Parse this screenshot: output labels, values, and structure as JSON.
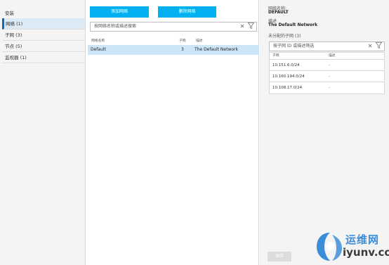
{
  "nav": {
    "title": "安装",
    "items": [
      {
        "label": "网络 (1)",
        "selected": true
      },
      {
        "label": "子网 (3)",
        "selected": false
      },
      {
        "label": "节点 (5)",
        "selected": false
      },
      {
        "label": "监视器 (1)",
        "selected": false
      }
    ]
  },
  "middle": {
    "add_button": "添加网络",
    "delete_button": "删除网络",
    "search_placeholder": "按网络名称或描述搜索",
    "columns": [
      "网络名称",
      "子网",
      "描述"
    ],
    "rows": [
      {
        "name": "Default",
        "subnets": "3",
        "description": "The Default Network"
      }
    ]
  },
  "right": {
    "name_label": "网络名称:",
    "name_value": "DEFAULT",
    "desc_label": "描述",
    "desc_value": "The Default Network",
    "unassigned_label": "未分配的子网 (3)",
    "filter_placeholder": "按子网 ID 或描述筛选",
    "columns": [
      "子网",
      "描述"
    ],
    "subnets": [
      {
        "subnet": "10.151.6.0/24",
        "description": "-"
      },
      {
        "subnet": "10.160.194.0/24",
        "description": "-"
      },
      {
        "subnet": "10.108.17.0/24",
        "description": "-"
      }
    ],
    "save_button": "保存"
  },
  "watermark": {
    "cn": "运维网",
    "en": "iyunv.com"
  },
  "colors": {
    "accent": "#00b0f0",
    "selection": "#cde6f7",
    "nav_selected_bar": "#0f6cbd",
    "watermark_blue": "#3c8dd8"
  }
}
